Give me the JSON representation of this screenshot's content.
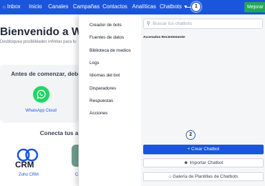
{
  "nav": {
    "items": [
      {
        "label": "Inbox",
        "icon": "home-icon"
      },
      {
        "label": "Inicio"
      },
      {
        "label": "Canales"
      },
      {
        "label": "Campañas"
      },
      {
        "label": "Contactos"
      },
      {
        "label": "Analíticas"
      },
      {
        "label": "Chatbots",
        "icon": "chevron-down-icon"
      }
    ],
    "upgrade_label": "Mejorar",
    "step1": "1"
  },
  "page": {
    "title": "Bienvenido a WOZT",
    "subtitle": "Desbloquea posibilidades infinitas para tu",
    "start_card_title": "Antes de comenzar, debes",
    "whatsapp_label": "WhatsApp Cloud",
    "connect_title": "Conecta tus ap",
    "crm_logo_text": "CRM",
    "crm_label": "Zoho CRM",
    "app2_label": "Ca"
  },
  "dropdown": {
    "menu": [
      "Creador de bots",
      "Fuentes de datos",
      "Biblioteca de medios",
      "Logs",
      "Idiomas del bot",
      "Disparadores",
      "Respuestas",
      "Acciones"
    ],
    "search_placeholder": "Buscar tus chatbots",
    "recent_label": "Accesados Recientemente",
    "step2": "2",
    "create_label": "+ Crear Chatbot",
    "import_label": "Importar Chatbot",
    "gallery_label": "Galería de Plantillas de Chatbots"
  },
  "colors": {
    "nav_bg": "#1a56db",
    "primary": "#1a56db",
    "upgrade": "#22a75a",
    "whatsapp": "#25d366"
  }
}
